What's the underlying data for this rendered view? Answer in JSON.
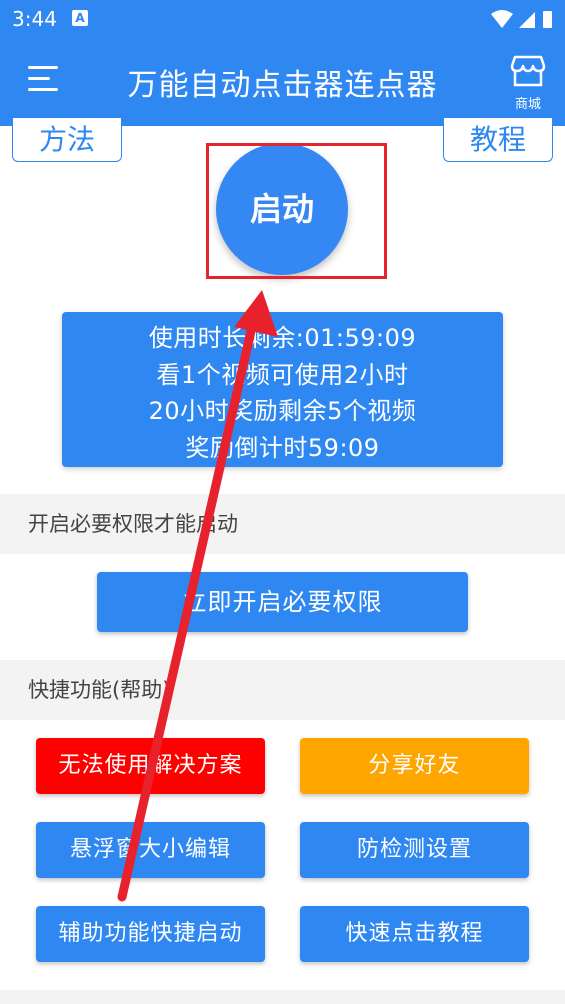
{
  "status": {
    "time": "3:44",
    "notif": "A"
  },
  "app_bar": {
    "title": "万能自动点击器连点器",
    "shop_label": "商城"
  },
  "top_buttons": {
    "method": "方法",
    "tutorial": "教程"
  },
  "start_button": "启动",
  "info_card": {
    "lines": [
      "使用时长剩余:01:59:09",
      "看1个视频可使用2小时",
      "20小时奖励剩余5个视频",
      "奖励倒计时59:09"
    ]
  },
  "permissions": {
    "header": "开启必要权限才能启动",
    "button": "立即开启必要权限"
  },
  "quick": {
    "header": "快捷功能(帮助)",
    "buttons": [
      "无法使用解决方案",
      "分享好友",
      "悬浮窗大小编辑",
      "防检测设置",
      "辅助功能快捷启动",
      "快速点击教程"
    ]
  },
  "colors": {
    "primary": "#2f88f2",
    "red": "#ff0000",
    "orange": "#ffa500",
    "highlight": "#e5252d"
  }
}
